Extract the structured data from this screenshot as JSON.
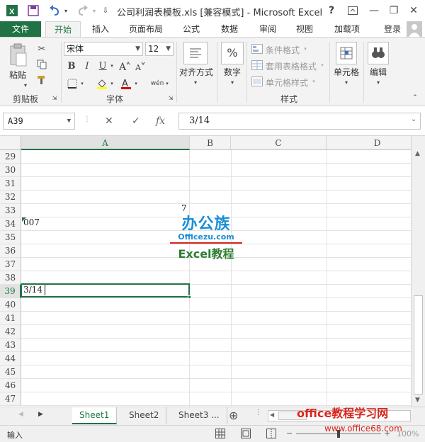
{
  "window": {
    "title": "公司利润表模板.xls  [兼容模式] - Microsoft Excel",
    "help": "?",
    "minimize": "—",
    "restore": "❐",
    "close": "✕"
  },
  "ribbon_tabs": [
    {
      "label": "文件"
    },
    {
      "label": "开始"
    },
    {
      "label": "插入"
    },
    {
      "label": "页面布局"
    },
    {
      "label": "公式"
    },
    {
      "label": "数据"
    },
    {
      "label": "审阅"
    },
    {
      "label": "视图"
    },
    {
      "label": "加载项"
    }
  ],
  "signin": "登录",
  "ribbon": {
    "clipboard": {
      "paste": "粘贴",
      "label": "剪贴板"
    },
    "font": {
      "name": "宋体",
      "size": "12",
      "label": "字体",
      "bold": "B",
      "italic": "I",
      "underline": "U"
    },
    "alignment": {
      "label": "对齐方式"
    },
    "number": {
      "label": "数字",
      "percent": "%"
    },
    "styles": {
      "conditional": "条件格式",
      "table": "套用表格格式",
      "cell_styles": "单元格样式",
      "label": "样式"
    },
    "cells": {
      "label": "单元格"
    },
    "editing": {
      "label": "编辑"
    }
  },
  "formula_bar": {
    "namebox": "A39",
    "cancel": "✕",
    "enter": "✓",
    "fx": "fx",
    "value": "3/14"
  },
  "columns": [
    {
      "label": "A",
      "selected": true
    },
    {
      "label": "B",
      "selected": false
    },
    {
      "label": "C",
      "selected": false
    },
    {
      "label": "D",
      "selected": false
    }
  ],
  "rows": [
    "29",
    "30",
    "31",
    "32",
    "33",
    "34",
    "35",
    "36",
    "37",
    "38",
    "39",
    "40",
    "41",
    "42",
    "43",
    "44",
    "45",
    "46",
    "47"
  ],
  "selected_row": "39",
  "cells": {
    "b33": "7",
    "a34": "007",
    "a39": "3/14"
  },
  "logo": {
    "top": "办公族",
    "site": "Officezu.com",
    "bottom": "Excel教程"
  },
  "sheet_tabs": [
    {
      "label": "Sheet1",
      "active": true
    },
    {
      "label": "Sheet2",
      "active": false
    },
    {
      "label": "Sheet3 ...",
      "active": false
    }
  ],
  "add_sheet": "⊕",
  "status": {
    "mode": "输入",
    "zoom": "100%"
  },
  "watermark": {
    "site": "office教程学习网",
    "url": "www.office68.com"
  },
  "colors": {
    "accent": "#217346",
    "watermark": "#d9261c",
    "logo_blue": "#1a8fd6",
    "logo_green": "#2e7d32"
  }
}
